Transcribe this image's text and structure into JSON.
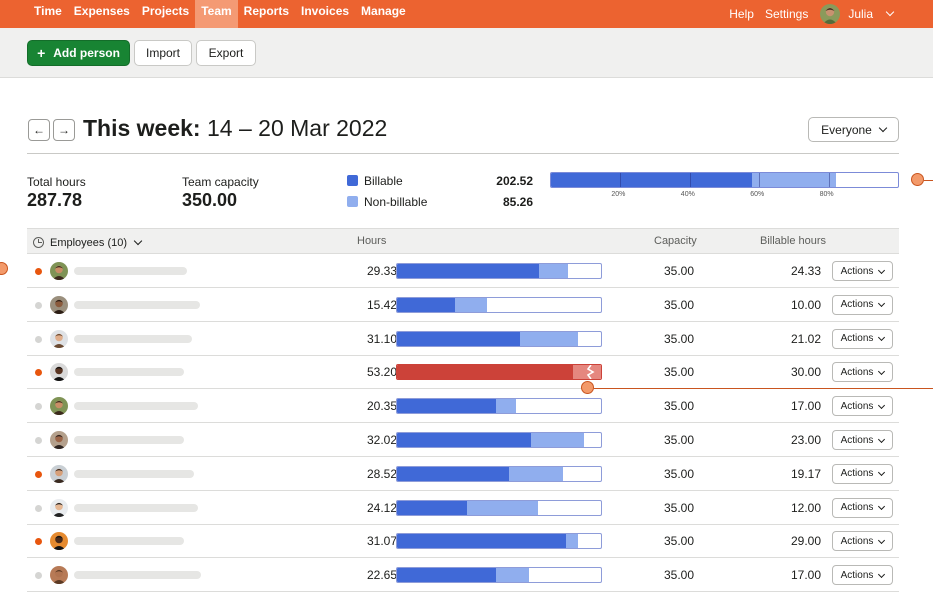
{
  "nav": {
    "items": [
      "Time",
      "Expenses",
      "Projects",
      "Team",
      "Reports",
      "Invoices",
      "Manage"
    ],
    "active_index": 3,
    "help": "Help",
    "settings": "Settings",
    "user": "Julia",
    "colors": {
      "bar": "#ec6330",
      "active": "#f49a74"
    }
  },
  "toolbar": {
    "add_person": "Add person",
    "import": "Import",
    "export": "Export"
  },
  "week": {
    "prefix": "This week:",
    "range": "14 – 20 Mar 2022",
    "prev_icon": "arrow-left-icon",
    "next_icon": "arrow-right-icon",
    "filter": "Everyone"
  },
  "summary": {
    "total_label": "Total hours",
    "total_value": "287.78",
    "capacity_label": "Team capacity",
    "capacity_value": "350.00",
    "billable_label": "Billable",
    "billable_value": "202.52",
    "nonbillable_label": "Non-billable",
    "nonbillable_value": "85.26",
    "capacity_bar": {
      "billable_fraction": 0.5786,
      "nonbillable_fraction": 0.2436,
      "ticks": [
        "20%",
        "40%",
        "60%",
        "80%"
      ]
    },
    "colors": {
      "billable": "#4069d7",
      "nonbillable": "#90aeee"
    }
  },
  "table": {
    "headers": {
      "employees": "Employees (10)",
      "hours": "Hours",
      "capacity": "Capacity",
      "billable": "Billable hours"
    },
    "actions_label": "Actions",
    "rows": [
      {
        "status": "orange",
        "hours": "29.33",
        "billable_hours": "24.33",
        "capacity": "35.00",
        "h": 29.33,
        "b": 24.33,
        "cap": 35,
        "over": false
      },
      {
        "status": "gray",
        "hours": "15.42",
        "billable_hours": "10.00",
        "capacity": "35.00",
        "h": 15.42,
        "b": 10.0,
        "cap": 35,
        "over": false
      },
      {
        "status": "gray",
        "hours": "31.10",
        "billable_hours": "21.02",
        "capacity": "35.00",
        "h": 31.1,
        "b": 21.02,
        "cap": 35,
        "over": false
      },
      {
        "status": "orange",
        "hours": "53.20",
        "billable_hours": "30.00",
        "capacity": "35.00",
        "h": 53.2,
        "b": 30.0,
        "cap": 35,
        "over": true
      },
      {
        "status": "gray",
        "hours": "20.35",
        "billable_hours": "17.00",
        "capacity": "35.00",
        "h": 20.35,
        "b": 17.0,
        "cap": 35,
        "over": false
      },
      {
        "status": "gray",
        "hours": "32.02",
        "billable_hours": "23.00",
        "capacity": "35.00",
        "h": 32.02,
        "b": 23.0,
        "cap": 35,
        "over": false
      },
      {
        "status": "orange",
        "hours": "28.52",
        "billable_hours": "19.17",
        "capacity": "35.00",
        "h": 28.52,
        "b": 19.17,
        "cap": 35,
        "over": false
      },
      {
        "status": "gray",
        "hours": "24.12",
        "billable_hours": "12.00",
        "capacity": "35.00",
        "h": 24.12,
        "b": 12.0,
        "cap": 35,
        "over": false
      },
      {
        "status": "orange",
        "hours": "31.07",
        "billable_hours": "29.00",
        "capacity": "35.00",
        "h": 31.07,
        "b": 29.0,
        "cap": 35,
        "over": false
      },
      {
        "status": "gray",
        "hours": "22.65",
        "billable_hours": "17.00",
        "capacity": "35.00",
        "h": 22.65,
        "b": 17.0,
        "cap": 35,
        "over": false
      }
    ],
    "colors": {
      "orange": "#e8560e",
      "gray": "#d5d5d3",
      "over_billable": "#cc4239",
      "over_nonbillable": "#e5877f",
      "billable": "#4069d7",
      "nonbillable": "#90aeee"
    }
  }
}
